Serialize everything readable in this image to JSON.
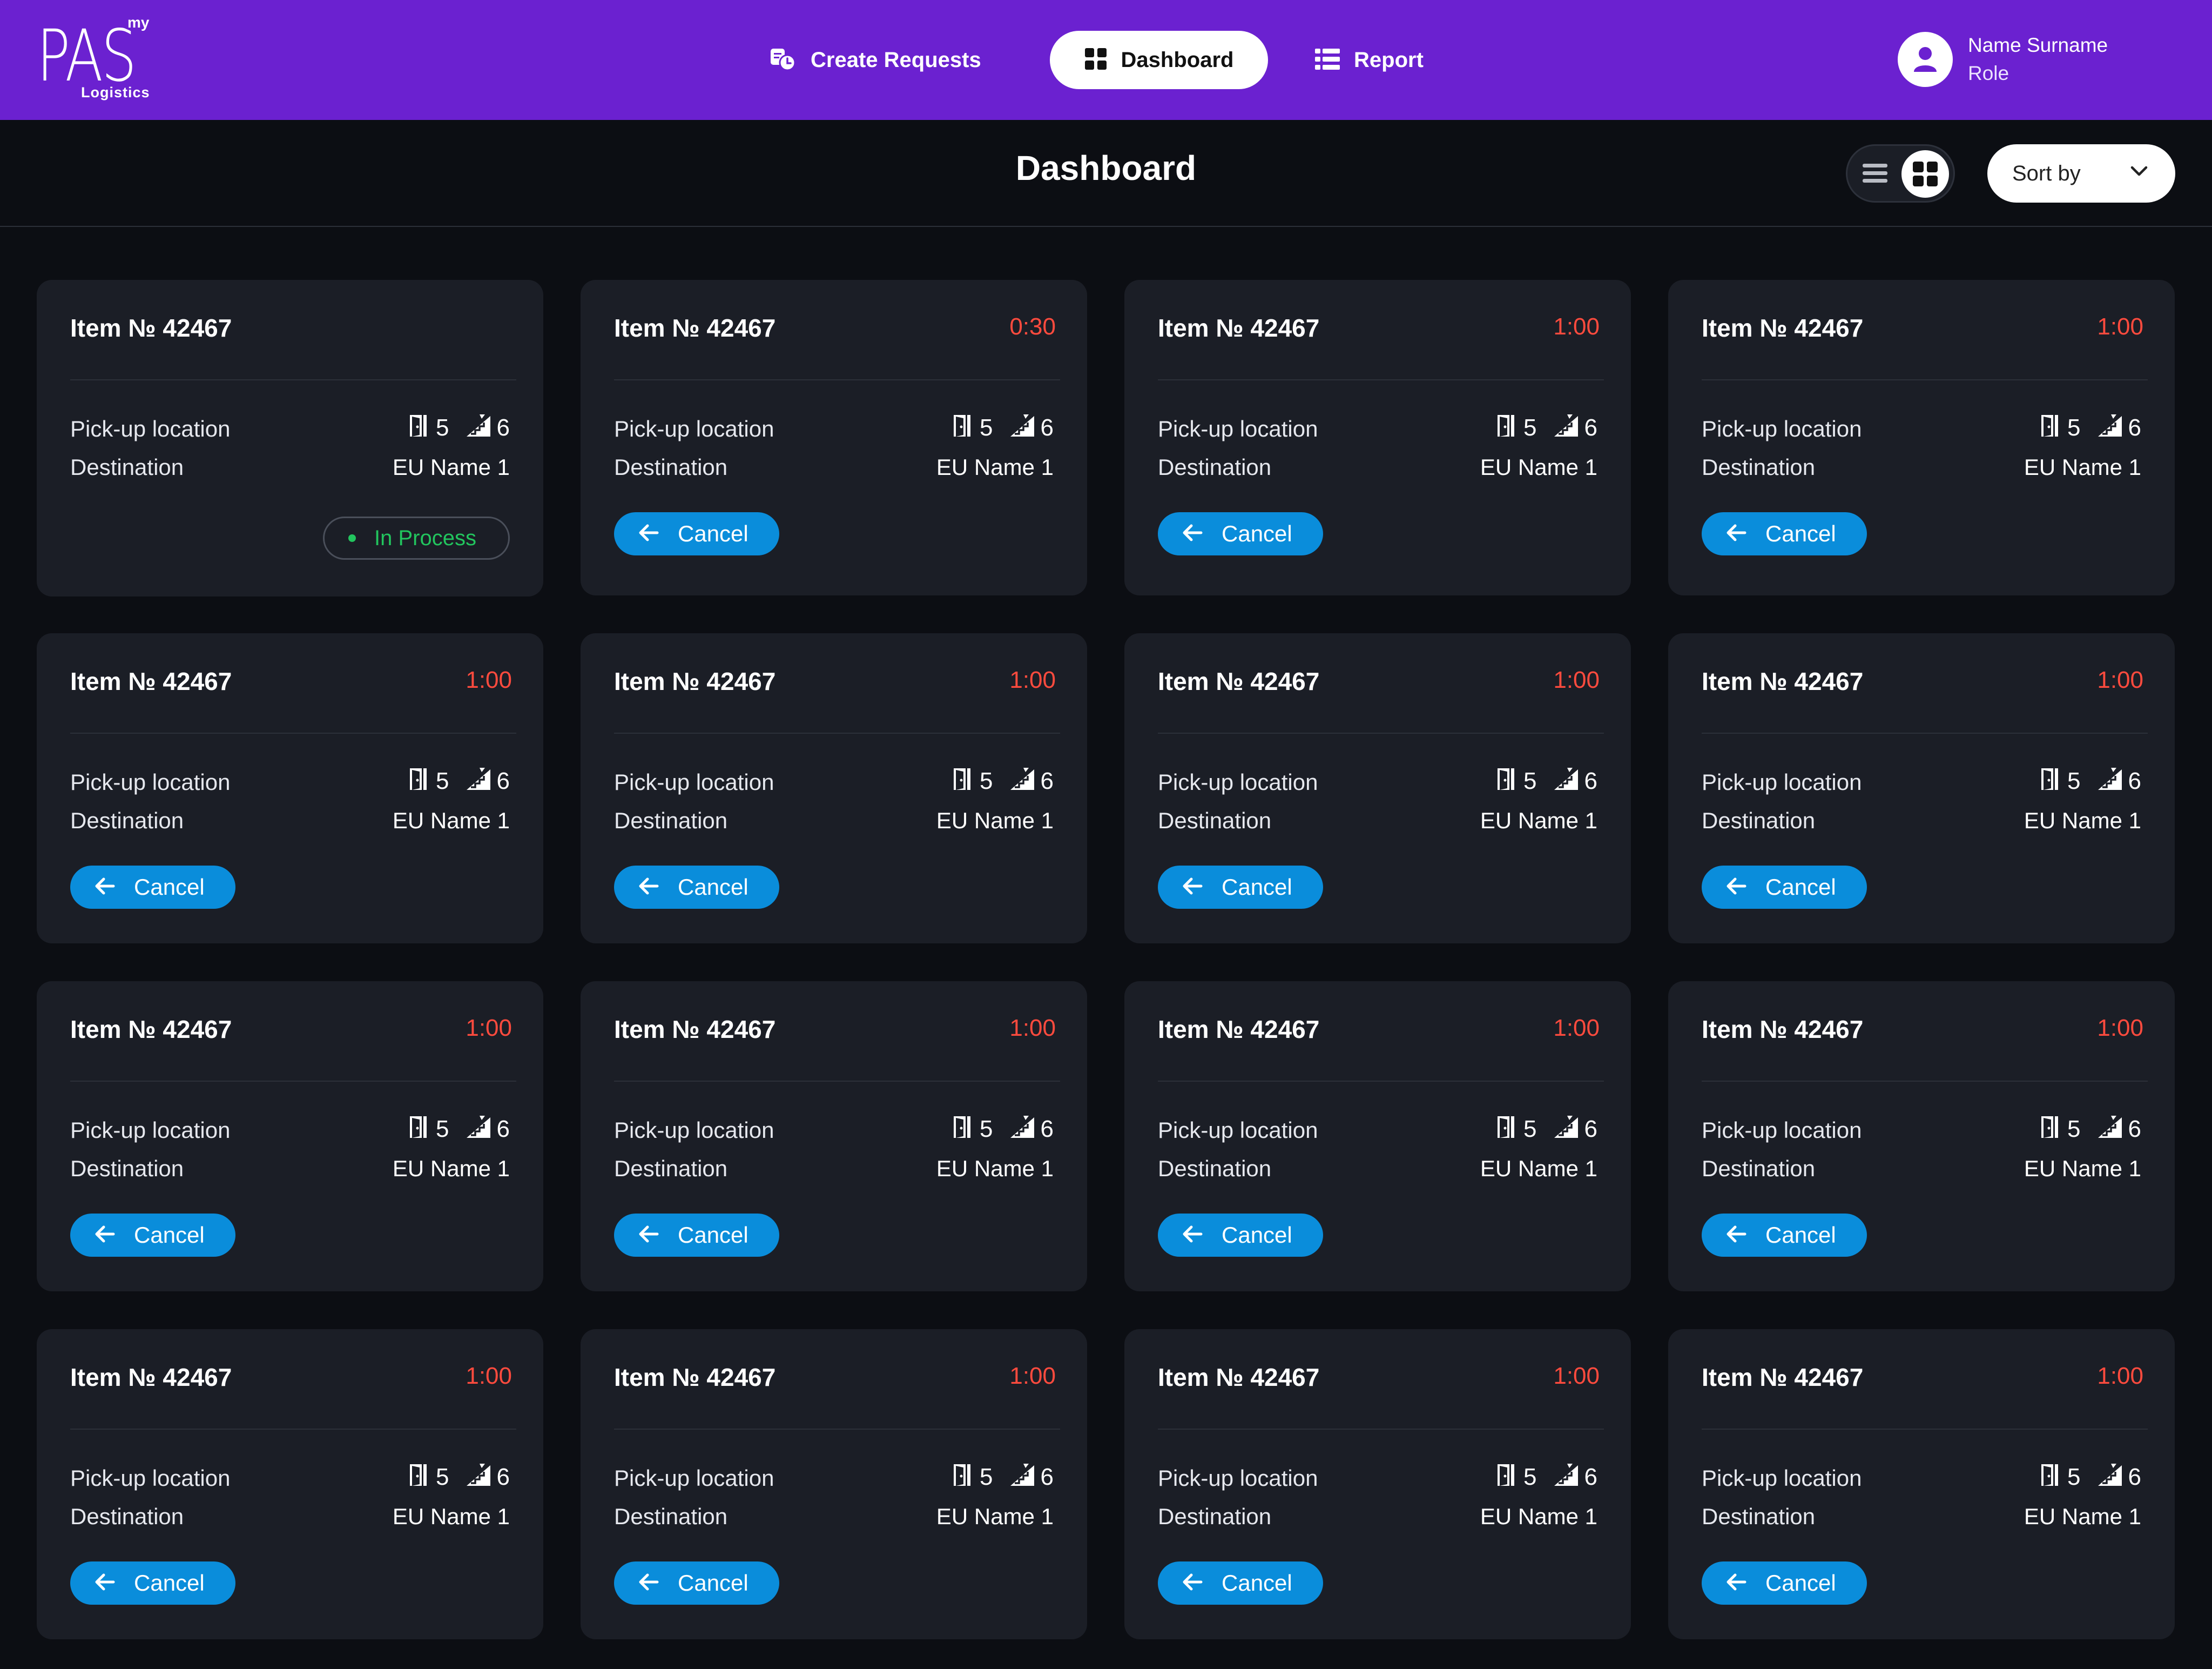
{
  "header": {
    "logo": {
      "main": "PAS",
      "superscript": "my",
      "subtitle": "Logistics"
    },
    "nav": [
      {
        "label": "Create Requests",
        "icon": "requests-icon",
        "active": false
      },
      {
        "label": "Dashboard",
        "icon": "grid-icon",
        "active": true
      },
      {
        "label": "Report",
        "icon": "list-icon",
        "active": false
      }
    ],
    "user": {
      "name": "Name Surname",
      "role": "Role",
      "icon": "user-icon"
    }
  },
  "page": {
    "title": "Dashboard",
    "view_toggle": {
      "options": [
        "list-view-icon",
        "grid-view-icon"
      ],
      "selected": "grid"
    },
    "sort": {
      "label": "Sort by",
      "icon": "chevron-down-icon"
    }
  },
  "colors": {
    "header_bg": "#6b21d0",
    "page_bg": "#0c0e13",
    "card_bg": "#1b1e26",
    "timer": "#ff4b3e",
    "cancel_button": "#0a8ddb",
    "status_green": "#22c55e"
  },
  "cards": [
    {
      "item": "Item № 42467",
      "timer": "",
      "pickup": "Pick-up location",
      "destination": "Destination",
      "doors": "5",
      "ramps": "6",
      "eu_name": "EU Name 1",
      "action": "status",
      "action_label": "In Process"
    },
    {
      "item": "Item № 42467",
      "timer": "0:30",
      "pickup": "Pick-up location",
      "destination": "Destination",
      "doors": "5",
      "ramps": "6",
      "eu_name": "EU Name 1",
      "action": "cancel",
      "action_label": "Cancel"
    },
    {
      "item": "Item № 42467",
      "timer": "1:00",
      "pickup": "Pick-up location",
      "destination": "Destination",
      "doors": "5",
      "ramps": "6",
      "eu_name": "EU Name 1",
      "action": "cancel",
      "action_label": "Cancel"
    },
    {
      "item": "Item № 42467",
      "timer": "1:00",
      "pickup": "Pick-up location",
      "destination": "Destination",
      "doors": "5",
      "ramps": "6",
      "eu_name": "EU Name 1",
      "action": "cancel",
      "action_label": "Cancel"
    },
    {
      "item": "Item № 42467",
      "timer": "1:00",
      "pickup": "Pick-up location",
      "destination": "Destination",
      "doors": "5",
      "ramps": "6",
      "eu_name": "EU Name 1",
      "action": "cancel",
      "action_label": "Cancel"
    },
    {
      "item": "Item № 42467",
      "timer": "1:00",
      "pickup": "Pick-up location",
      "destination": "Destination",
      "doors": "5",
      "ramps": "6",
      "eu_name": "EU Name 1",
      "action": "cancel",
      "action_label": "Cancel"
    },
    {
      "item": "Item № 42467",
      "timer": "1:00",
      "pickup": "Pick-up location",
      "destination": "Destination",
      "doors": "5",
      "ramps": "6",
      "eu_name": "EU Name 1",
      "action": "cancel",
      "action_label": "Cancel"
    },
    {
      "item": "Item № 42467",
      "timer": "1:00",
      "pickup": "Pick-up location",
      "destination": "Destination",
      "doors": "5",
      "ramps": "6",
      "eu_name": "EU Name 1",
      "action": "cancel",
      "action_label": "Cancel"
    },
    {
      "item": "Item № 42467",
      "timer": "1:00",
      "pickup": "Pick-up location",
      "destination": "Destination",
      "doors": "5",
      "ramps": "6",
      "eu_name": "EU Name 1",
      "action": "cancel",
      "action_label": "Cancel"
    },
    {
      "item": "Item № 42467",
      "timer": "1:00",
      "pickup": "Pick-up location",
      "destination": "Destination",
      "doors": "5",
      "ramps": "6",
      "eu_name": "EU Name 1",
      "action": "cancel",
      "action_label": "Cancel"
    },
    {
      "item": "Item № 42467",
      "timer": "1:00",
      "pickup": "Pick-up location",
      "destination": "Destination",
      "doors": "5",
      "ramps": "6",
      "eu_name": "EU Name 1",
      "action": "cancel",
      "action_label": "Cancel"
    },
    {
      "item": "Item № 42467",
      "timer": "1:00",
      "pickup": "Pick-up location",
      "destination": "Destination",
      "doors": "5",
      "ramps": "6",
      "eu_name": "EU Name 1",
      "action": "cancel",
      "action_label": "Cancel"
    },
    {
      "item": "Item № 42467",
      "timer": "1:00",
      "pickup": "Pick-up location",
      "destination": "Destination",
      "doors": "5",
      "ramps": "6",
      "eu_name": "EU Name 1",
      "action": "cancel",
      "action_label": "Cancel"
    },
    {
      "item": "Item № 42467",
      "timer": "1:00",
      "pickup": "Pick-up location",
      "destination": "Destination",
      "doors": "5",
      "ramps": "6",
      "eu_name": "EU Name 1",
      "action": "cancel",
      "action_label": "Cancel"
    },
    {
      "item": "Item № 42467",
      "timer": "1:00",
      "pickup": "Pick-up location",
      "destination": "Destination",
      "doors": "5",
      "ramps": "6",
      "eu_name": "EU Name 1",
      "action": "cancel",
      "action_label": "Cancel"
    },
    {
      "item": "Item № 42467",
      "timer": "1:00",
      "pickup": "Pick-up location",
      "destination": "Destination",
      "doors": "5",
      "ramps": "6",
      "eu_name": "EU Name 1",
      "action": "cancel",
      "action_label": "Cancel"
    }
  ]
}
